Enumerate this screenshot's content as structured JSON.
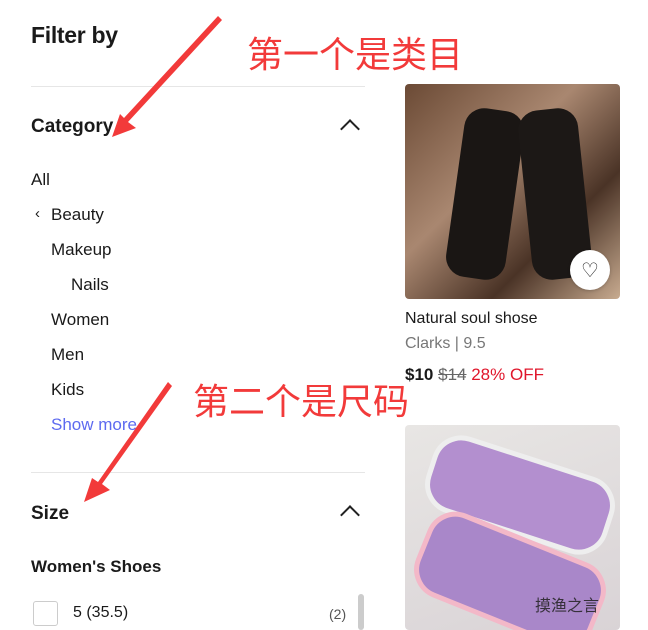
{
  "filter": {
    "title": "Filter by",
    "category": {
      "label": "Category",
      "items": [
        "All",
        "Beauty",
        "Makeup",
        "Nails",
        "Women",
        "Men",
        "Kids"
      ],
      "show_more": "Show more"
    },
    "size": {
      "label": "Size",
      "group": "Women's Shoes",
      "options": [
        {
          "label": "5 (35.5)",
          "count": "(2)",
          "checked": false
        }
      ]
    }
  },
  "products": [
    {
      "name": "Natural soul shose",
      "brand_size": "Clarks | 9.5",
      "price": "$10",
      "original_price": "$14",
      "discount": "28% OFF"
    },
    {}
  ],
  "annotations": [
    "第一个是类目",
    "第二个是尺码"
  ],
  "watermark": "摸渔之言",
  "colors": {
    "link": "#5d6af0",
    "discount": "#e0162b",
    "annotation": "#f23a3a"
  }
}
